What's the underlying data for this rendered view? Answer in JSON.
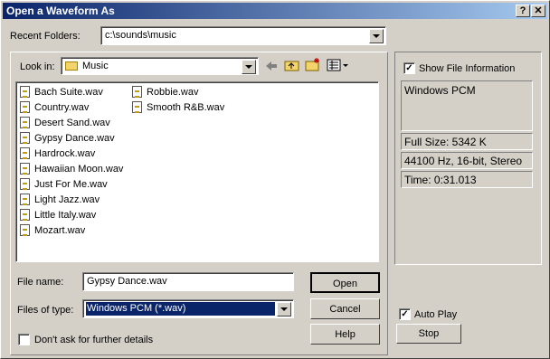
{
  "window": {
    "title": "Open a Waveform As",
    "help_btn": "?",
    "close_btn": "✕"
  },
  "recent": {
    "label": "Recent Folders:",
    "value": "c:\\sounds\\music"
  },
  "lookin": {
    "label": "Look in:",
    "value": "Music"
  },
  "files_col1": [
    "Bach Suite.wav",
    "Country.wav",
    "Desert Sand.wav",
    "Gypsy Dance.wav",
    "Hardrock.wav",
    "Hawaiian Moon.wav",
    "Just For Me.wav",
    "Light Jazz.wav",
    "Little Italy.wav",
    "Mozart.wav"
  ],
  "files_col2": [
    "Robbie.wav",
    "Smooth R&B.wav"
  ],
  "filename": {
    "label": "File name:",
    "value": "Gypsy Dance.wav"
  },
  "filetype": {
    "label": "Files of type:",
    "value": "Windows PCM (*.wav)"
  },
  "dontask": {
    "label": "Don't ask for further details",
    "checked": false
  },
  "buttons": {
    "open": "Open",
    "cancel": "Cancel",
    "help": "Help",
    "stop": "Stop"
  },
  "info": {
    "show_label": "Show File Information",
    "format": "Windows PCM",
    "size": "Full Size: 5342 K",
    "rate": "44100 Hz, 16-bit, Stereo",
    "time": "Time:   0:31.013"
  },
  "autoplay": {
    "label": "Auto Play",
    "checked": true
  },
  "colors": {
    "title_start": "#0a246a",
    "title_end": "#a6caf0",
    "face": "#d4d0c8",
    "selection": "#0a246a"
  },
  "icons": [
    "folder-icon",
    "up-arrow-icon",
    "up-folder-icon",
    "new-folder-icon",
    "view-menu-icon",
    "wav-file-icon"
  ]
}
